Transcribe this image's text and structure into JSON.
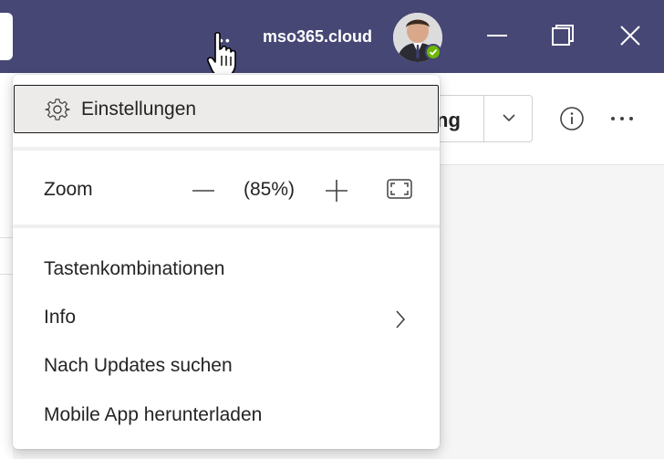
{
  "titlebar": {
    "tenant_name": "mso365.cloud",
    "more_icon": "more-horizontal-icon",
    "window_buttons": [
      "minimize-icon",
      "restore-icon",
      "close-icon"
    ],
    "colors": {
      "titlebar_bg": "#464775",
      "presence": "#6bb700"
    }
  },
  "background": {
    "split_button_label": "ng"
  },
  "menu": {
    "settings_label": "Einstellungen",
    "zoom": {
      "label": "Zoom",
      "value": "(85%)"
    },
    "items": [
      {
        "label": "Tastenkombinationen"
      },
      {
        "label": "Info",
        "has_submenu": true
      },
      {
        "label": "Nach Updates suchen"
      },
      {
        "label": "Mobile App herunterladen"
      }
    ]
  }
}
